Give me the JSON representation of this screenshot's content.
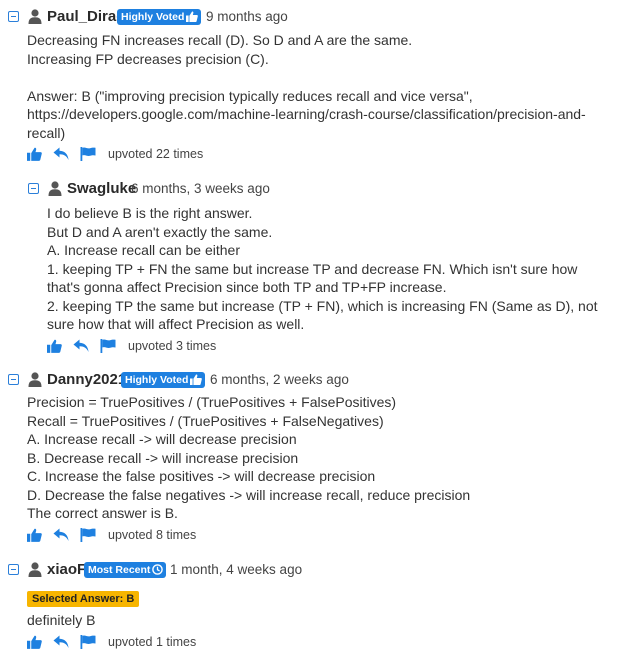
{
  "comments": [
    {
      "username": "Paul_Dirac",
      "badge": "Highly Voted",
      "badge_icon": "thumbs-up-icon",
      "time": "9 months ago",
      "lines": [
        "Decreasing FN increases recall (D). So D and A are the same.",
        "Increasing FP decreases precision (C).",
        "",
        "Answer: B (\"improving precision typically reduces recall and vice versa\",",
        "https://developers.google.com/machine-learning/crash-course/classification/precision-and-",
        "recall)"
      ],
      "upvoted": "upvoted 22 times"
    },
    {
      "username": "Swagluke",
      "time": "6 months, 3 weeks ago",
      "lines": [
        "I do believe B is the right answer.",
        "But D and A aren't exactly the same.",
        "A. Increase recall can be either",
        "1. keeping TP + FN the same but increase TP and decrease FN. Which isn't sure how",
        "that's gonna affect Precision since both TP and TP+FP increase.",
        "2. keeping TP the same but increase (TP + FN), which is increasing FN (Same as D), not",
        "sure how that will affect Precision as well."
      ],
      "upvoted": "upvoted 3 times"
    },
    {
      "username": "Danny2021",
      "badge": "Highly Voted",
      "badge_icon": "thumbs-up-icon",
      "time": "6 months, 2 weeks ago",
      "lines": [
        "Precision = TruePositives / (TruePositives + FalsePositives)",
        "Recall = TruePositives / (TruePositives + FalseNegatives)",
        "A. Increase recall -> will decrease precision",
        "B. Decrease recall -> will increase precision",
        "C. Increase the false positives -> will decrease precision",
        "D. Decrease the false negatives -> will increase recall, reduce precision",
        "The correct answer is B."
      ],
      "upvoted": "upvoted 8 times"
    },
    {
      "username": "xiaoF",
      "badge": "Most Recent",
      "badge_icon": "clock-icon",
      "time": "1 month, 4 weeks ago",
      "selected_answer": "Selected Answer: B",
      "lines": [
        "definitely B"
      ],
      "upvoted": "upvoted 1 times"
    }
  ],
  "colors": {
    "accent": "#1e80e0",
    "selected_badge": "#f7b500",
    "text": "#333333"
  }
}
